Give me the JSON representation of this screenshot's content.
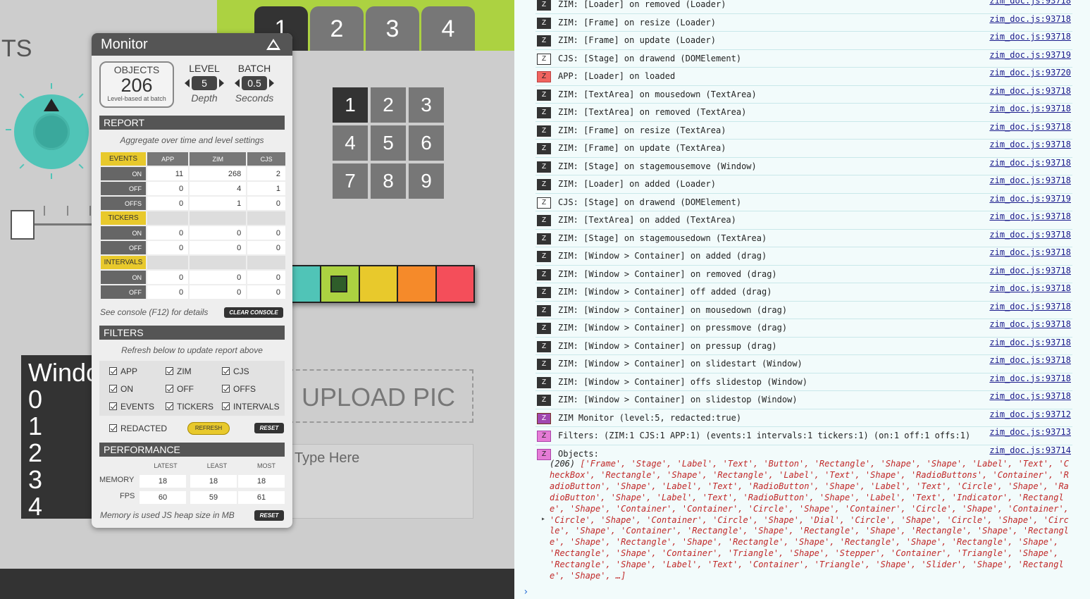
{
  "app": {
    "tabs": [
      "1",
      "2",
      "3",
      "4"
    ],
    "ts_label": "TS",
    "pad": [
      "1",
      "2",
      "3",
      "4",
      "5",
      "6",
      "7",
      "8",
      "9"
    ],
    "swatch_colors": [
      "#50c4b7",
      "#acd241",
      "#e8c92c",
      "#f58a2a",
      "#f44e5a"
    ],
    "upload": "UPLOAD PIC",
    "textarea_placeholder": "Type Here",
    "window_lines": [
      "Windo",
      "0",
      "1",
      "2",
      "3",
      "4"
    ]
  },
  "monitor": {
    "title": "Monitor",
    "objects_label": "OBJECTS",
    "objects_value": "206",
    "objects_sub": "Level-based at batch",
    "level_label": "LEVEL",
    "level_value": "5",
    "level_sub": "Depth",
    "batch_label": "BATCH",
    "batch_value": "0.5",
    "batch_sub": "Seconds",
    "report_title": "REPORT",
    "report_note": "Aggregate over time and level settings",
    "cols": [
      "APP",
      "ZIM",
      "CJS"
    ],
    "events_label": "EVENTS",
    "events": [
      {
        "label": "ON",
        "v": [
          "11",
          "268",
          "2"
        ]
      },
      {
        "label": "OFF",
        "v": [
          "0",
          "4",
          "1"
        ]
      },
      {
        "label": "OFFS",
        "v": [
          "0",
          "1",
          "0"
        ]
      }
    ],
    "tickers_label": "TICKERS",
    "tickers": [
      {
        "label": "ON",
        "v": [
          "0",
          "0",
          "0"
        ]
      },
      {
        "label": "OFF",
        "v": [
          "0",
          "0",
          "0"
        ]
      }
    ],
    "intervals_label": "INTERVALS",
    "intervals": [
      {
        "label": "ON",
        "v": [
          "0",
          "0",
          "0"
        ]
      },
      {
        "label": "OFF",
        "v": [
          "0",
          "0",
          "0"
        ]
      }
    ],
    "console_note": "See console (F12) for details",
    "clear_console": "CLEAR CONSOLE",
    "filters_title": "FILTERS",
    "filters_note": "Refresh below to update report above",
    "filters": [
      "APP",
      "ZIM",
      "CJS",
      "ON",
      "OFF",
      "OFFS",
      "EVENTS",
      "TICKERS",
      "INTERVALS"
    ],
    "redacted": "REDACTED",
    "refresh": "REFRESH",
    "reset": "RESET",
    "performance_title": "PERFORMANCE",
    "perf_cols": [
      "LATEST",
      "LEAST",
      "MOST"
    ],
    "memory_label": "MEMORY",
    "memory": [
      "18",
      "18",
      "18"
    ],
    "fps_label": "FPS",
    "fps": [
      "60",
      "59",
      "61"
    ],
    "perf_note": "Memory is used JS heap size in MB"
  },
  "console": {
    "rows": [
      {
        "b": "Z",
        "t": "zim",
        "m": "ZIM: [Loader] on removed (Loader)",
        "s": "zim_doc.js:93718"
      },
      {
        "b": "Z",
        "t": "zim",
        "m": "ZIM: [Frame] on resize (Loader)",
        "s": "zim_doc.js:93718"
      },
      {
        "b": "Z",
        "t": "zim",
        "m": "ZIM: [Frame] on update (Loader)",
        "s": "zim_doc.js:93718"
      },
      {
        "b": "Z",
        "t": "cjs",
        "m": "CJS: [Stage] on drawend (DOMElement)",
        "s": "zim_doc.js:93719"
      },
      {
        "b": "Z",
        "t": "app",
        "m": "APP: [Loader] on loaded",
        "s": "zim_doc.js:93720"
      },
      {
        "b": "Z",
        "t": "zim",
        "m": "ZIM: [TextArea] on mousedown (TextArea)",
        "s": "zim_doc.js:93718"
      },
      {
        "b": "Z",
        "t": "zim",
        "m": "ZIM: [TextArea] on removed (TextArea)",
        "s": "zim_doc.js:93718"
      },
      {
        "b": "Z",
        "t": "zim",
        "m": "ZIM: [Frame] on resize (TextArea)",
        "s": "zim_doc.js:93718"
      },
      {
        "b": "Z",
        "t": "zim",
        "m": "ZIM: [Frame] on update (TextArea)",
        "s": "zim_doc.js:93718"
      },
      {
        "b": "Z",
        "t": "zim",
        "m": "ZIM: [Stage] on stagemousemove (Window)",
        "s": "zim_doc.js:93718"
      },
      {
        "b": "Z",
        "t": "zim",
        "m": "ZIM: [Loader] on added (Loader)",
        "s": "zim_doc.js:93718"
      },
      {
        "b": "Z",
        "t": "cjs",
        "m": "CJS: [Stage] on drawend (DOMElement)",
        "s": "zim_doc.js:93719"
      },
      {
        "b": "Z",
        "t": "zim",
        "m": "ZIM: [TextArea] on added (TextArea)",
        "s": "zim_doc.js:93718"
      },
      {
        "b": "Z",
        "t": "zim",
        "m": "ZIM: [Stage] on stagemousedown (TextArea)",
        "s": "zim_doc.js:93718"
      },
      {
        "b": "Z",
        "t": "zim",
        "m": "ZIM: [Window > Container] on added (drag)",
        "s": "zim_doc.js:93718"
      },
      {
        "b": "Z",
        "t": "zim",
        "m": "ZIM: [Window > Container] on removed (drag)",
        "s": "zim_doc.js:93718"
      },
      {
        "b": "Z",
        "t": "zim",
        "m": "ZIM: [Window > Container] off added (drag)",
        "s": "zim_doc.js:93718"
      },
      {
        "b": "Z",
        "t": "zim",
        "m": "ZIM: [Window > Container] on mousedown (drag)",
        "s": "zim_doc.js:93718"
      },
      {
        "b": "Z",
        "t": "zim",
        "m": "ZIM: [Window > Container] on pressmove (drag)",
        "s": "zim_doc.js:93718"
      },
      {
        "b": "Z",
        "t": "zim",
        "m": "ZIM: [Window > Container] on pressup (drag)",
        "s": "zim_doc.js:93718"
      },
      {
        "b": "Z",
        "t": "zim",
        "m": "ZIM: [Window > Container] on slidestart (Window)",
        "s": "zim_doc.js:93718"
      },
      {
        "b": "Z",
        "t": "zim",
        "m": "ZIM: [Window > Container] offs slidestop (Window)",
        "s": "zim_doc.js:93718"
      },
      {
        "b": "Z",
        "t": "zim",
        "m": "ZIM: [Window > Container] on slidestop (Window)",
        "s": "zim_doc.js:93718"
      },
      {
        "b": "Z",
        "t": "mon",
        "m": "ZIM Monitor (level:5, redacted:true)",
        "s": "zim_doc.js:93712"
      },
      {
        "b": "Z",
        "t": "pink",
        "m": "Filters: (ZIM:1 CJS:1 APP:1) (events:1 intervals:1 tickers:1) (on:1 off:1 offs:1)",
        "s": "zim_doc.js:93713"
      },
      {
        "b": "Z",
        "t": "pink",
        "m": "Objects:",
        "s": "zim_doc.js:93714"
      }
    ],
    "objects_count": "(206)",
    "objects_list": "['Frame', 'Stage', 'Label', 'Text', 'Button', 'Rectangle', 'Shape', 'Shape', 'Label', 'Text', 'CheckBox', 'Rectangle', 'Shape', 'Rectangle', 'Label', 'Text', 'Shape', 'RadioButtons', 'Container', 'RadioButton', 'Shape', 'Label', 'Text', 'RadioButton', 'Shape', 'Label', 'Text', 'Circle', 'Shape', 'RadioButton', 'Shape', 'Label', 'Text', 'RadioButton', 'Shape', 'Label', 'Text', 'Indicator', 'Rectangle', 'Shape', 'Container', 'Container', 'Circle', 'Shape', 'Container', 'Circle', 'Shape', 'Container', 'Circle', 'Shape', 'Container', 'Circle', 'Shape', 'Dial', 'Circle', 'Shape', 'Circle', 'Shape', 'Circle', 'Shape', 'Container', 'Rectangle', 'Shape', 'Rectangle', 'Shape', 'Rectangle', 'Shape', 'Rectangle', 'Shape', 'Rectangle', 'Shape', 'Rectangle', 'Shape', 'Rectangle', 'Shape', 'Rectangle', 'Shape', 'Rectangle', 'Shape', 'Container', 'Triangle', 'Shape', 'Stepper', 'Container', 'Triangle', 'Shape', 'Rectangle', 'Shape', 'Label', 'Text', 'Container', 'Triangle', 'Shape', 'Slider', 'Shape', 'Rectangle', 'Shape', …]",
    "prompt": "›"
  }
}
